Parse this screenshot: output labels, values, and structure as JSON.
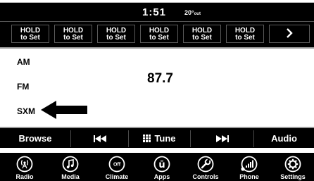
{
  "status": {
    "time": "1:51",
    "temp_value": "20°",
    "temp_suffix": "out"
  },
  "presets": [
    {
      "line1": "HOLD",
      "line2": "to Set"
    },
    {
      "line1": "HOLD",
      "line2": "to Set"
    },
    {
      "line1": "HOLD",
      "line2": "to Set"
    },
    {
      "line1": "HOLD",
      "line2": "to Set"
    },
    {
      "line1": "HOLD",
      "line2": "to Set"
    },
    {
      "line1": "HOLD",
      "line2": "to Set"
    }
  ],
  "presets_next_icon": "chevron-right-icon",
  "bands": [
    "AM",
    "FM",
    "SXM"
  ],
  "frequency": "87.7",
  "controls": {
    "browse": "Browse",
    "prev_icon": "seek-back-icon",
    "tune": "Tune",
    "next_icon": "seek-forward-icon",
    "audio": "Audio"
  },
  "dock": [
    {
      "label": "Radio",
      "icon": "radio-icon"
    },
    {
      "label": "Media",
      "icon": "media-icon"
    },
    {
      "label": "Climate",
      "icon": "climate-icon",
      "icon_text": "Off"
    },
    {
      "label": "Apps",
      "icon": "apps-icon",
      "icon_text": "ū"
    },
    {
      "label": "Controls",
      "icon": "controls-icon"
    },
    {
      "label": "Phone",
      "icon": "phone-icon"
    },
    {
      "label": "Settings",
      "icon": "settings-icon"
    }
  ]
}
